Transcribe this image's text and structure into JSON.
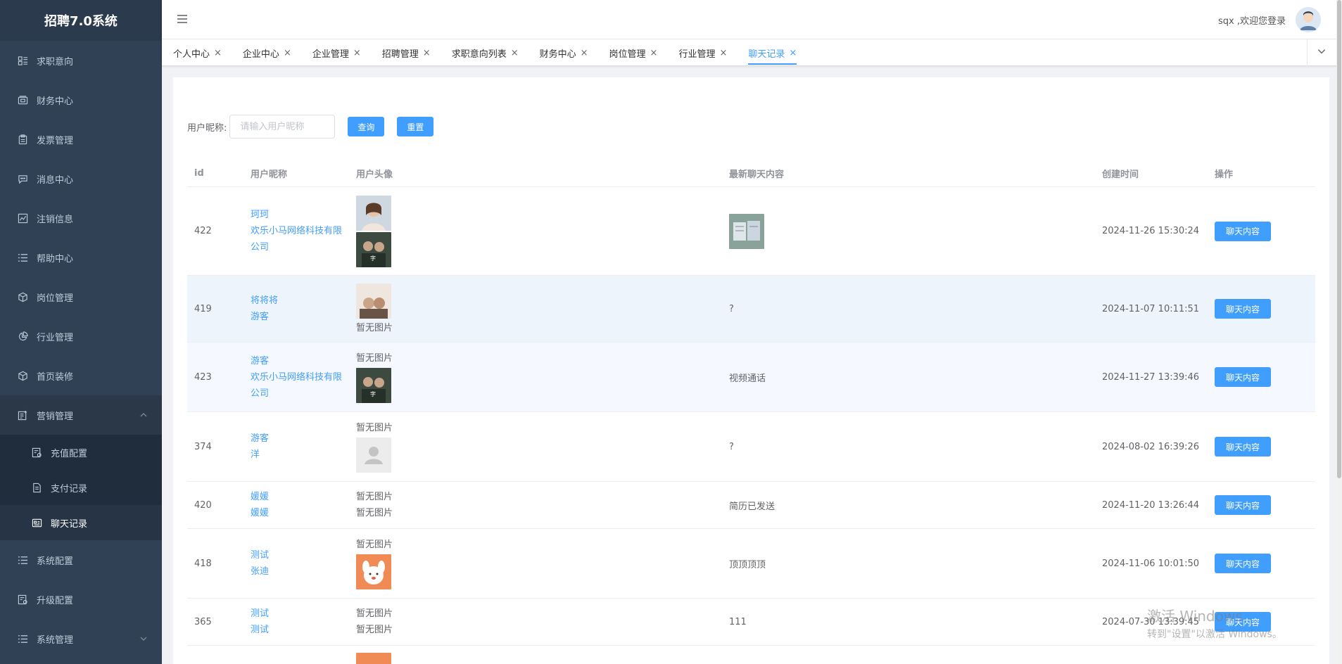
{
  "app_title": "招聘7.0系统",
  "sidebar": {
    "items": [
      {
        "label": "求职意向",
        "icon": "list-icon"
      },
      {
        "label": "财务中心",
        "icon": "wallet-icon"
      },
      {
        "label": "发票管理",
        "icon": "clipboard-icon"
      },
      {
        "label": "消息中心",
        "icon": "chat-icon"
      },
      {
        "label": "注销信息",
        "icon": "chart-icon"
      },
      {
        "label": "帮助中心",
        "icon": "menu-icon"
      },
      {
        "label": "岗位管理",
        "icon": "box-icon"
      },
      {
        "label": "行业管理",
        "icon": "pie-icon"
      },
      {
        "label": "首页装修",
        "icon": "box-icon"
      },
      {
        "label": "营销管理",
        "icon": "edit-icon"
      }
    ],
    "marketing_sub": [
      {
        "label": "充值配置"
      },
      {
        "label": "支付记录"
      },
      {
        "label": "聊天记录"
      }
    ],
    "bottom_items": [
      {
        "label": "系统配置"
      },
      {
        "label": "升级配置"
      },
      {
        "label": "系统管理"
      }
    ]
  },
  "header": {
    "welcome": "sqx ,欢迎您登录"
  },
  "tabs": [
    {
      "label": "个人中心"
    },
    {
      "label": "企业中心"
    },
    {
      "label": "企业管理"
    },
    {
      "label": "招聘管理"
    },
    {
      "label": "求职意向列表"
    },
    {
      "label": "财务中心"
    },
    {
      "label": "岗位管理"
    },
    {
      "label": "行业管理"
    },
    {
      "label": "聊天记录"
    }
  ],
  "search": {
    "label": "用户昵称:",
    "placeholder": "请输入用户昵称",
    "query_btn": "查询",
    "reset_btn": "重置"
  },
  "table": {
    "headers": {
      "id": "id",
      "nickname": "用户昵称",
      "avatar": "用户头像",
      "message": "最新聊天内容",
      "time": "创建时间",
      "op": "操作"
    },
    "op_label": "聊天内容",
    "no_image": "暂无图片",
    "rows": [
      {
        "id": "422",
        "nick1": "珂珂",
        "nick2": "欢乐小马网络科技有限公司",
        "message": "",
        "time": "2024-11-26 15:30:24"
      },
      {
        "id": "419",
        "nick1": "将将将",
        "nick2": "游客",
        "message": "?",
        "time": "2024-11-07 10:11:51"
      },
      {
        "id": "423",
        "nick1": "游客",
        "nick2": "欢乐小马网络科技有限公司",
        "message": "视频通话",
        "time": "2024-11-27 13:39:46"
      },
      {
        "id": "374",
        "nick1": "游客",
        "nick2": "洋",
        "message": "?",
        "time": "2024-08-02 16:39:26"
      },
      {
        "id": "420",
        "nick1": "媛媛",
        "nick2": "媛媛",
        "message": "简历已发送",
        "time": "2024-11-20 13:26:44"
      },
      {
        "id": "418",
        "nick1": "测试",
        "nick2": "张迪",
        "message": "顶顶顶顶",
        "time": "2024-11-06 10:01:50"
      },
      {
        "id": "365",
        "nick1": "测试",
        "nick2": "测试",
        "message": "111",
        "time": "2024-07-30 13:39:45"
      }
    ]
  },
  "watermark": {
    "line1": "激活 Windows",
    "line2": "转到\"设置\"以激活 Windows。"
  },
  "colors": {
    "sidebar_bg": "#304156",
    "accent": "#409eff"
  }
}
